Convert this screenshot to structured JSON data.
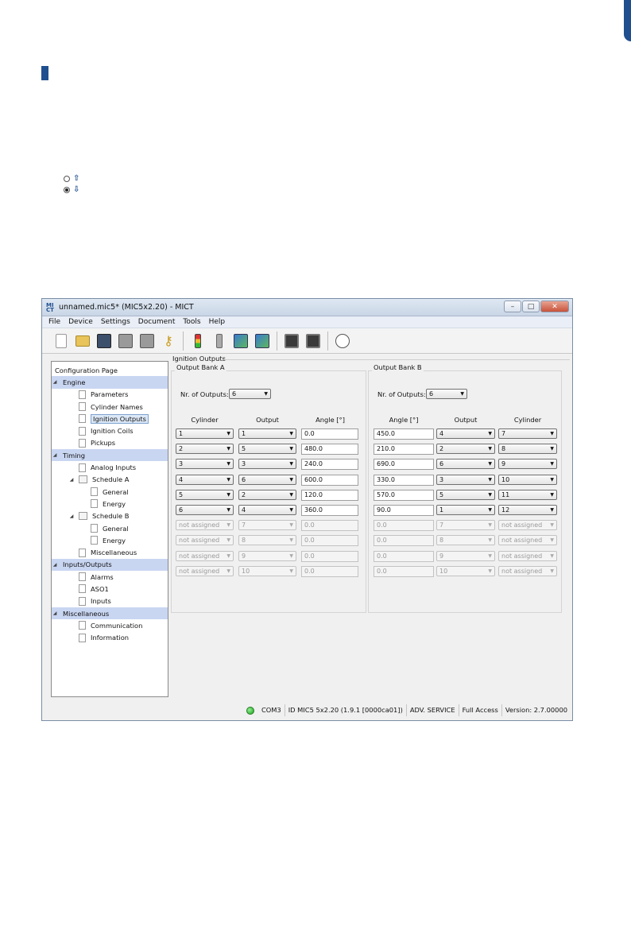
{
  "window": {
    "logo": "MI CT",
    "title": "unnamed.mic5* (MIC5x2.20) - MICT"
  },
  "menu": [
    "File",
    "Device",
    "Settings",
    "Document",
    "Tools",
    "Help"
  ],
  "tree": {
    "header": "Configuration Page",
    "groups": [
      {
        "label": "Engine",
        "items": [
          "Parameters",
          "Cylinder Names",
          "Ignition Outputs",
          "Ignition Coils",
          "Pickups"
        ]
      },
      {
        "label": "Timing",
        "items": [
          "Analog Inputs",
          "Schedule A",
          "General",
          "Energy",
          "Schedule B",
          "General",
          "Energy",
          "Miscellaneous"
        ]
      },
      {
        "label": "Inputs/Outputs",
        "items": [
          "Alarms",
          "ASO1",
          "Inputs"
        ]
      },
      {
        "label": "Miscellaneous",
        "items": [
          "Communication",
          "Information"
        ]
      }
    ]
  },
  "section": {
    "title": "Ignition Outputs",
    "bank_a": {
      "title": "Output Bank A",
      "nr_label": "Nr. of Outputs:",
      "nr_value": "6",
      "headers": [
        "Cylinder",
        "Output",
        "Angle [°]"
      ],
      "rows": [
        [
          "1",
          "1",
          "0.0"
        ],
        [
          "2",
          "5",
          "480.0"
        ],
        [
          "3",
          "3",
          "240.0"
        ],
        [
          "4",
          "6",
          "600.0"
        ],
        [
          "5",
          "2",
          "120.0"
        ],
        [
          "6",
          "4",
          "360.0"
        ],
        [
          "not assigned",
          "7",
          "0.0"
        ],
        [
          "not assigned",
          "8",
          "0.0"
        ],
        [
          "not assigned",
          "9",
          "0.0"
        ],
        [
          "not assigned",
          "10",
          "0.0"
        ]
      ]
    },
    "bank_b": {
      "title": "Output Bank B",
      "nr_label": "Nr. of Outputs:",
      "nr_value": "6",
      "headers": [
        "Angle [°]",
        "Output",
        "Cylinder"
      ],
      "rows": [
        [
          "450.0",
          "4",
          "7"
        ],
        [
          "210.0",
          "2",
          "8"
        ],
        [
          "690.0",
          "6",
          "9"
        ],
        [
          "330.0",
          "3",
          "10"
        ],
        [
          "570.0",
          "5",
          "11"
        ],
        [
          "90.0",
          "1",
          "12"
        ],
        [
          "0.0",
          "7",
          "not assigned"
        ],
        [
          "0.0",
          "8",
          "not assigned"
        ],
        [
          "0.0",
          "9",
          "not assigned"
        ],
        [
          "0.0",
          "10",
          "not assigned"
        ]
      ]
    }
  },
  "status": {
    "port": "COM3",
    "device_id": "ID MIC5 5x2.20 (1.9.1 [0000ca01])",
    "mode": "ADV. SERVICE",
    "access": "Full Access",
    "version": "Version: 2.7.00000"
  },
  "colors": {
    "accent": "#1f4f8f",
    "tree_category": "#c9d6f2",
    "status_led": "#2ec02e"
  }
}
